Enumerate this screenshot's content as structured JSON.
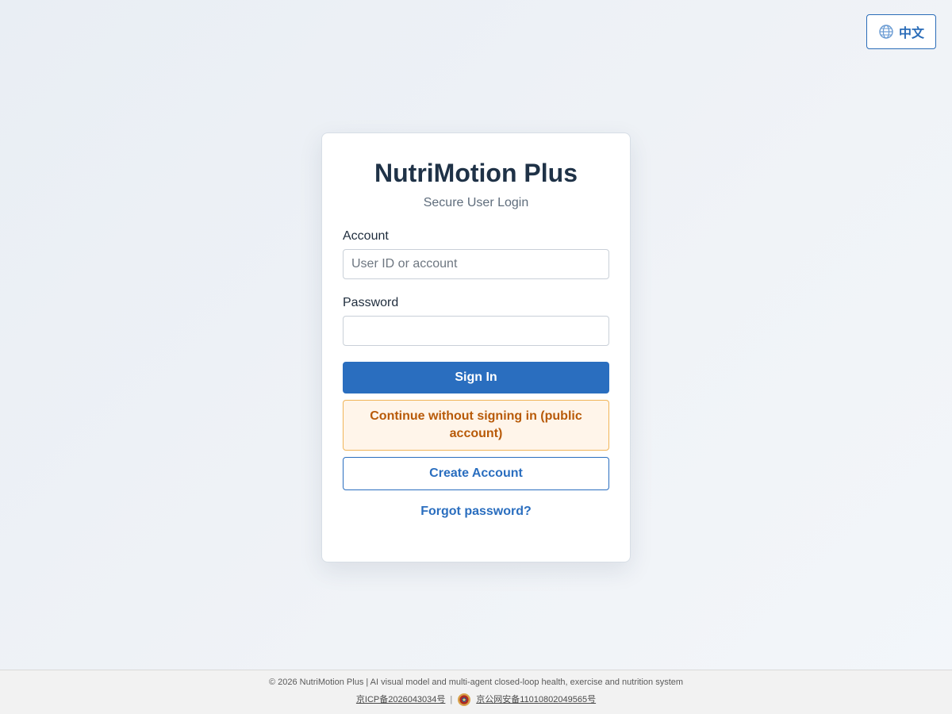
{
  "language_switch": {
    "label": "中文",
    "icon": "globe-icon",
    "color": "#2a6cb8"
  },
  "login": {
    "title": "NutriMotion Plus",
    "subtitle": "Secure User Login",
    "account_label": "Account",
    "account_placeholder": "User ID or account",
    "account_value": "",
    "password_label": "Password",
    "password_value": "",
    "sign_in_label": "Sign In",
    "public_label": "Continue without signing in (public account)",
    "create_account_label": "Create Account",
    "forgot_label": "Forgot password?"
  },
  "footer": {
    "copyright": "© 2026 NutriMotion Plus | AI visual model and multi-agent closed-loop health, exercise and nutrition system",
    "icp": "京ICP备2026043034号",
    "separator": "|",
    "police_record": "京公网安备11010802049565号",
    "police_icon": "police-badge-icon"
  },
  "colors": {
    "primary": "#2a6ebf",
    "warning_text": "#b85a08",
    "warning_bg": "#fff5ea",
    "warning_border": "#f0b458"
  }
}
